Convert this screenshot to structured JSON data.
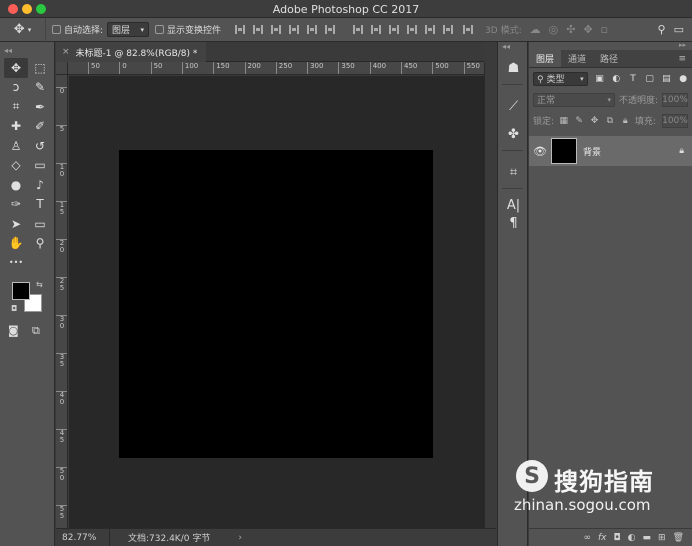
{
  "window": {
    "title": "Adobe Photoshop CC 2017"
  },
  "options_bar": {
    "move_tool_icon": "move-icon",
    "auto_select_label": "自动选择:",
    "auto_select_value": "图层",
    "show_transform_label": "显示变换控件",
    "mode_3d_label": "3D 模式:"
  },
  "toolbar": {
    "tools": [
      {
        "name": "move-tool",
        "glyph": "✥",
        "active": true
      },
      {
        "name": "marquee-tool",
        "glyph": "⬚"
      },
      {
        "name": "lasso-tool",
        "glyph": "ↄ"
      },
      {
        "name": "quick-select-tool",
        "glyph": "✎"
      },
      {
        "name": "crop-tool",
        "glyph": "⌗"
      },
      {
        "name": "eyedropper-tool",
        "glyph": "✒"
      },
      {
        "name": "healing-tool",
        "glyph": "✚"
      },
      {
        "name": "brush-tool",
        "glyph": "✐"
      },
      {
        "name": "stamp-tool",
        "glyph": "♙"
      },
      {
        "name": "history-brush-tool",
        "glyph": "↺"
      },
      {
        "name": "eraser-tool",
        "glyph": "◇"
      },
      {
        "name": "gradient-tool",
        "glyph": "▭"
      },
      {
        "name": "blur-tool",
        "glyph": "●"
      },
      {
        "name": "dodge-tool",
        "glyph": "♪"
      },
      {
        "name": "pen-tool",
        "glyph": "✑"
      },
      {
        "name": "type-tool",
        "glyph": "T"
      },
      {
        "name": "path-select-tool",
        "glyph": "➤"
      },
      {
        "name": "rectangle-tool",
        "glyph": "▭"
      },
      {
        "name": "hand-tool",
        "glyph": "✋"
      },
      {
        "name": "zoom-tool",
        "glyph": "⚲"
      },
      {
        "name": "more-tools",
        "glyph": "•••"
      }
    ],
    "foreground_color": "#000000",
    "background_color": "#ffffff"
  },
  "document": {
    "tab_title": "未标题-1 @ 82.8%(RGB/8) *",
    "canvas_color": "#000000"
  },
  "ruler_h": {
    "labels": [
      "50",
      "0",
      "50",
      "100",
      "150",
      "200",
      "250",
      "300",
      "350",
      "400",
      "450",
      "500",
      "550"
    ]
  },
  "ruler_v": {
    "labels": [
      "0",
      "5",
      "1 0",
      "1 5",
      "2 0",
      "2 5",
      "3 0",
      "3 5",
      "4 0",
      "4 5",
      "5 0",
      "5 5"
    ]
  },
  "status": {
    "zoom": "82.77%",
    "doc_size": "文档:732.4K/0 字节"
  },
  "layers_panel": {
    "tabs": [
      "图层",
      "通道",
      "路径"
    ],
    "filter_label": "类型",
    "blend_mode": "正常",
    "opacity_label": "不透明度:",
    "opacity_value": "100%",
    "lock_label": "锁定:",
    "fill_label": "填充:",
    "fill_value": "100%",
    "layers": [
      {
        "name": "背景",
        "visible": true,
        "locked": true
      }
    ]
  },
  "watermark": {
    "logo_letter": "S",
    "brand": "搜狗指南",
    "url": "zhinan.sogou.com"
  }
}
